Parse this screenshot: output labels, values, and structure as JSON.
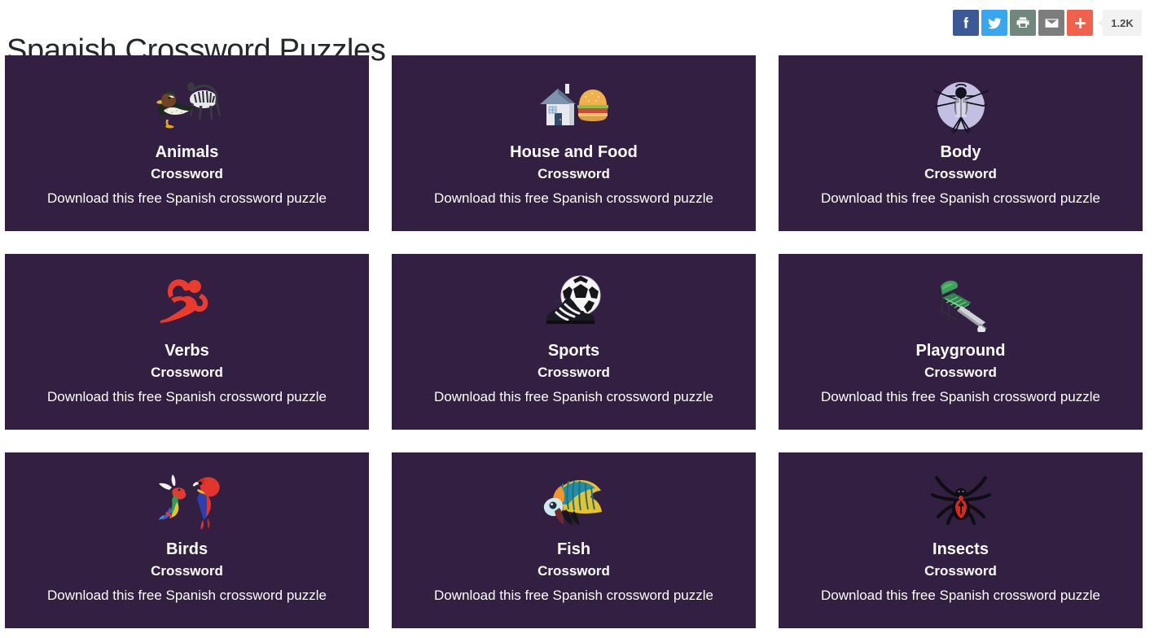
{
  "header": {
    "title": "Spanish Crossword Puzzles",
    "share": {
      "buttons": [
        {
          "name": "facebook-share-button",
          "label": "Facebook",
          "color": "#3b5998"
        },
        {
          "name": "twitter-share-button",
          "label": "Twitter",
          "color": "#36a7f0"
        },
        {
          "name": "print-button",
          "label": "Print",
          "color": "#71867d"
        },
        {
          "name": "email-share-button",
          "label": "Email",
          "color": "#7d7d7d"
        },
        {
          "name": "more-share-button",
          "label": "More",
          "color": "#f1614b"
        }
      ],
      "count_label": "1.2K"
    }
  },
  "theme": {
    "card_background": "#321f42",
    "card_text": "#ffffff",
    "title_color": "#24272c"
  },
  "cards": [
    {
      "title": "Animals",
      "subtitle": "Crossword",
      "description": "Download this free Spanish crossword puzzle",
      "icon": "duck-and-zebra-icon"
    },
    {
      "title": "House and Food",
      "subtitle": "Crossword",
      "description": "Download this free Spanish crossword puzzle",
      "icon": "house-and-burger-icon"
    },
    {
      "title": "Body",
      "subtitle": "Crossword",
      "description": "Download this free Spanish crossword puzzle",
      "icon": "vitruvian-man-icon"
    },
    {
      "title": "Verbs",
      "subtitle": "Crossword",
      "description": "Download this free Spanish crossword puzzle",
      "icon": "runner-icon"
    },
    {
      "title": "Sports",
      "subtitle": "Crossword",
      "description": "Download this free Spanish crossword puzzle",
      "icon": "soccer-ball-and-cleats-icon"
    },
    {
      "title": "Playground",
      "subtitle": "Crossword",
      "description": "Download this free Spanish crossword puzzle",
      "icon": "playground-slide-icon"
    },
    {
      "title": "Birds",
      "subtitle": "Crossword",
      "description": "Download this free Spanish crossword puzzle",
      "icon": "hummingbird-and-parrot-icon"
    },
    {
      "title": "Fish",
      "subtitle": "Crossword",
      "description": "Download this free Spanish crossword puzzle",
      "icon": "tropical-fish-icon"
    },
    {
      "title": "Insects",
      "subtitle": "Crossword",
      "description": "Download this free Spanish crossword puzzle",
      "icon": "spider-icon"
    }
  ]
}
